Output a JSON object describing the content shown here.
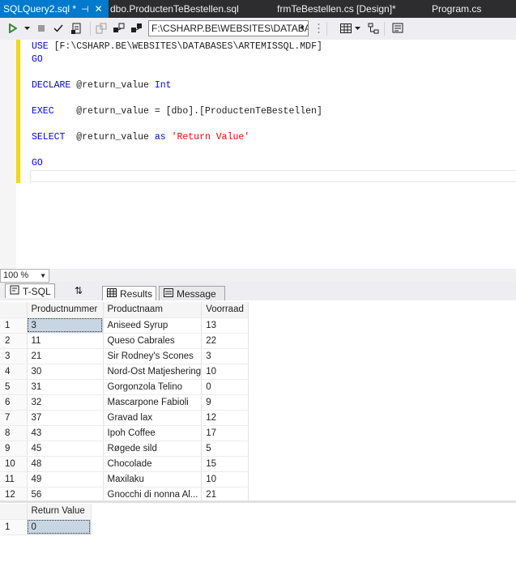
{
  "tabs": [
    {
      "label": "SQLQuery2.sql *",
      "active": true,
      "pin": "⊣",
      "close": "✕"
    },
    {
      "label": "dbo.ProductenTeBestellen.sql",
      "active": false
    },
    {
      "label": "frmTeBestellen.cs [Design]*",
      "active": false
    },
    {
      "label": "Program.cs",
      "active": false
    }
  ],
  "toolbar": {
    "database_path": "F:\\CSHARP.BE\\WEBSITES\\DATABA",
    "icons": [
      "execute-icon",
      "dropdown-icon",
      "stop-icon",
      "parse-checkmark-icon",
      "display-plan-icon",
      "query-options-icon",
      "include-plan-icon",
      "client-stats-icon",
      "results-to-grid-icon",
      "comment-icon",
      "specify-values-icon"
    ]
  },
  "editor": {
    "lines": [
      {
        "parts": [
          {
            "t": "kw",
            "v": "USE"
          },
          {
            "t": "txt",
            "v": " [F:\\CSHARP.BE\\WEBSITES\\DATABASES\\ARTEMISSQL.MDF]"
          }
        ]
      },
      {
        "parts": [
          {
            "t": "kw",
            "v": "GO"
          }
        ]
      },
      {
        "parts": [
          {
            "t": "txt",
            "v": ""
          }
        ]
      },
      {
        "parts": [
          {
            "t": "kw",
            "v": "DECLARE"
          },
          {
            "t": "txt",
            "v": " @return_value "
          },
          {
            "t": "kw",
            "v": "Int"
          }
        ]
      },
      {
        "parts": [
          {
            "t": "txt",
            "v": ""
          }
        ]
      },
      {
        "parts": [
          {
            "t": "kw",
            "v": "EXEC"
          },
          {
            "t": "txt",
            "v": "    @return_value = [dbo].[ProductenTeBestellen]"
          }
        ]
      },
      {
        "parts": [
          {
            "t": "txt",
            "v": ""
          }
        ]
      },
      {
        "parts": [
          {
            "t": "kw",
            "v": "SELECT"
          },
          {
            "t": "txt",
            "v": "  @return_value "
          },
          {
            "t": "kw",
            "v": "as"
          },
          {
            "t": "txt",
            "v": " "
          },
          {
            "t": "str",
            "v": "'Return Value'"
          }
        ]
      },
      {
        "parts": [
          {
            "t": "txt",
            "v": ""
          }
        ]
      },
      {
        "parts": [
          {
            "t": "kw",
            "v": "GO"
          }
        ]
      }
    ]
  },
  "zoom": "100 %",
  "results_tabs": {
    "tsql": "T-SQL",
    "sort_icon": "⇅",
    "results": "Results",
    "messages": "Message"
  },
  "grid1": {
    "columns": [
      "Productnummer",
      "Productnaam",
      "Voorraad"
    ],
    "rows": [
      [
        "1",
        "3",
        "Aniseed Syrup",
        "13"
      ],
      [
        "2",
        "11",
        "Queso Cabrales",
        "22"
      ],
      [
        "3",
        "21",
        "Sir Rodney's Scones",
        "3"
      ],
      [
        "4",
        "30",
        "Nord-Ost Matjeshering",
        "10"
      ],
      [
        "5",
        "31",
        "Gorgonzola Telino",
        "0"
      ],
      [
        "6",
        "32",
        "Mascarpone Fabioli",
        "9"
      ],
      [
        "7",
        "37",
        "Gravad lax",
        "12"
      ],
      [
        "8",
        "43",
        "Ipoh Coffee",
        "17"
      ],
      [
        "9",
        "45",
        "Røgede sild",
        "5"
      ],
      [
        "10",
        "48",
        "Chocolade",
        "15"
      ],
      [
        "11",
        "49",
        "Maxilaku",
        "10"
      ],
      [
        "12",
        "56",
        "Gnocchi di nonna Al...",
        "21"
      ]
    ]
  },
  "grid2": {
    "columns": [
      "Return Value"
    ],
    "rows": [
      [
        "1",
        "0"
      ]
    ]
  }
}
